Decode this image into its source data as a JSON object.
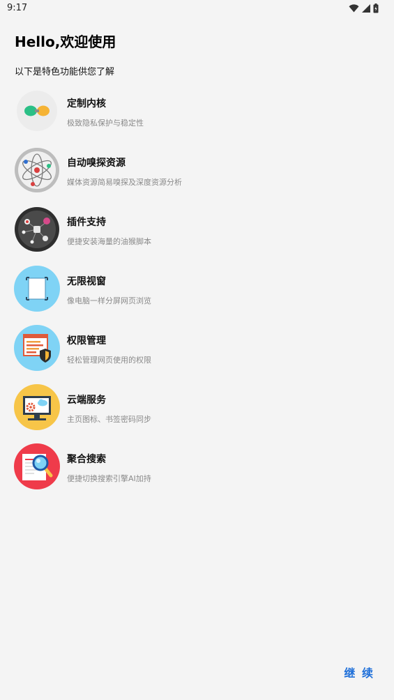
{
  "status_bar": {
    "time": "9:17",
    "icons": [
      "wifi-icon",
      "signal-icon",
      "battery-icon"
    ]
  },
  "header": {
    "title": "Hello,欢迎使用",
    "subtitle": "以下是特色功能供您了解"
  },
  "features": [
    {
      "title": "定制内核",
      "desc": "极致隐私保护与稳定性",
      "icon": "kernel-icon"
    },
    {
      "title": "自动嗅探资源",
      "desc": "媒体资源简易嗅探及深度资源分析",
      "icon": "atom-icon"
    },
    {
      "title": "插件支持",
      "desc": "便捷安装海量的油猴脚本",
      "icon": "plugin-network-icon"
    },
    {
      "title": "无限视窗",
      "desc": "像电脑一样分屏网页浏览",
      "icon": "window-icon"
    },
    {
      "title": "权限管理",
      "desc": "轻松管理网页使用的权限",
      "icon": "permission-shield-icon"
    },
    {
      "title": "云端服务",
      "desc": "主页图标、书签密码同步",
      "icon": "cloud-monitor-icon"
    },
    {
      "title": "聚合搜索",
      "desc": "便捷切换搜索引擎AI加持",
      "icon": "magnifier-icon"
    }
  ],
  "footer": {
    "continue_label": "继 续"
  },
  "colors": {
    "accent": "#1e6fd9",
    "background": "#f4f4f4",
    "desc_text": "#8a8a8a"
  }
}
